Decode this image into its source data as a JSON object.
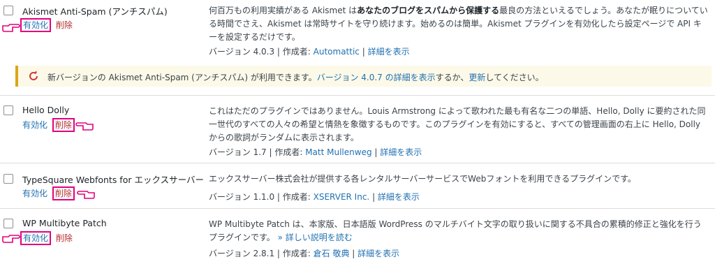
{
  "plugins": [
    {
      "name": "Akismet Anti-Spam (アンチスパム)",
      "activate": "有効化",
      "delete": "削除",
      "desc_part1": "何百万もの利用実績がある Akismet は",
      "desc_bold": "あなたのブログをスパムから保護する",
      "desc_part2": "最良の方法といえるでしょう。あなたが眠りについている時間でさえ、Akismet は常時サイトを守り続けます。始めるのは簡単。Akismet プラグインを有効化したら設定ページで API キーを設定するだけです。",
      "version_label": "バージョン 4.0.3 | 作成者: ",
      "author": "Automattic",
      "details": "詳細を表示"
    },
    {
      "name": "Hello Dolly",
      "activate": "有効化",
      "delete": "削除",
      "description": "これはただのプラグインではありません。Louis Armstrong によって歌われた最も有名な二つの単語、Hello, Dolly に要約された同一世代のすべての人々の希望と情熱を象徴するものです。このプラグインを有効にすると、すべての管理画面の右上に Hello, Dolly からの歌詞がランダムに表示されます。",
      "version_label": "バージョン 1.7 | 作成者: ",
      "author": "Matt Mullenweg",
      "details": "詳細を表示"
    },
    {
      "name": "TypeSquare Webfonts for エックスサーバー",
      "activate": "有効化",
      "delete": "削除",
      "description": "エックスサーバー株式会社が提供する各レンタルサーバーサービスでWebフォントを利用できるプラグインです。",
      "version_label": "バージョン 1.1.0 | 作成者: ",
      "author": "XSERVER Inc.",
      "details": "詳細を表示"
    },
    {
      "name": "WP Multibyte Patch",
      "activate": "有効化",
      "delete": "削除",
      "description": "WP Multibyte Patch は、本家版、日本語版 WordPress のマルチバイト文字の取り扱いに関する不具合の累積的修正と強化を行うプラグインです。",
      "more_link": "» 詳しい説明を読む",
      "version_label": "バージョン 2.8.1 | 作成者: ",
      "author": "倉石 敬典",
      "details": "詳細を表示"
    }
  ],
  "update_notice": {
    "text_before": "新バージョンの Akismet Anti-Spam (アンチスパム) が利用できます。",
    "version_link": "バージョン 4.0.7 の詳細を表示",
    "text_middle": "するか、",
    "update_link": "更新",
    "text_after": "してください。"
  },
  "colors": {
    "link": "#2271b1",
    "delete": "#b32d2e",
    "highlight": "#e3007f",
    "notice_bg": "#fcf9e8",
    "notice_border": "#dba617"
  },
  "icons": [
    "update-icon",
    "pointing-hand-icon"
  ]
}
